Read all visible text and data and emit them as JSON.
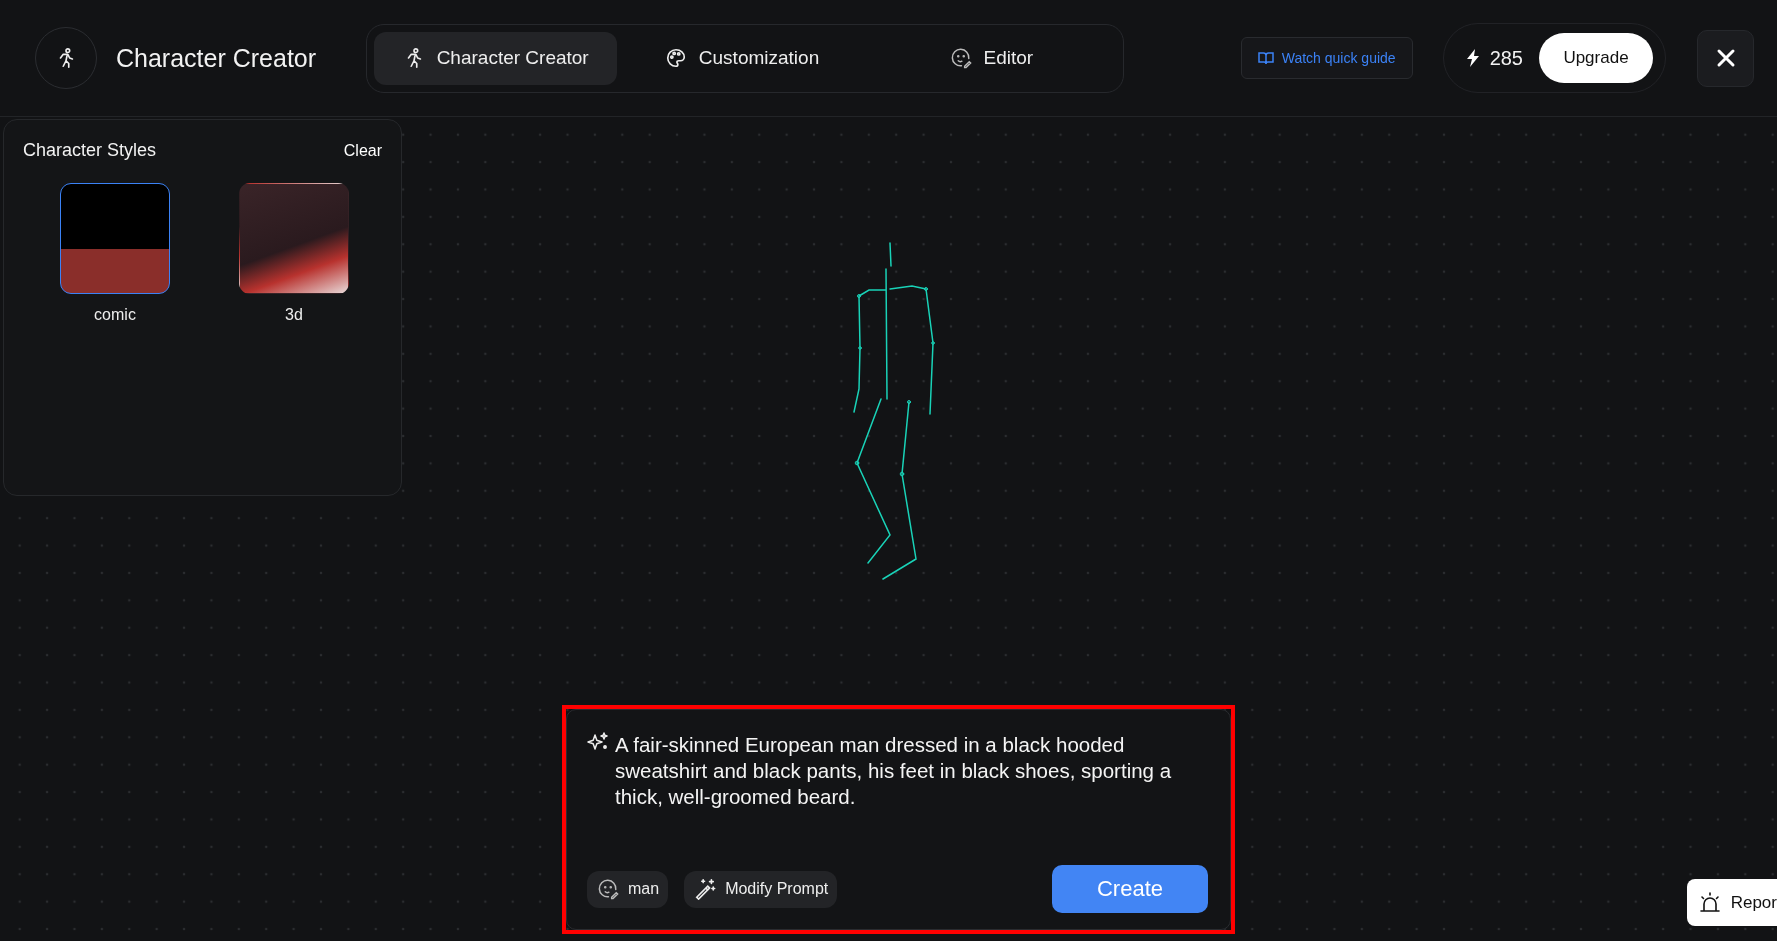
{
  "header": {
    "title": "Character Creator"
  },
  "tabs": [
    {
      "label": "Character Creator",
      "selected": true
    },
    {
      "label": "Customization",
      "selected": false
    },
    {
      "label": "Editor",
      "selected": false
    }
  ],
  "guide_link": "Watch quick guide",
  "credits": "285",
  "upgrade_button": "Upgrade",
  "styles_panel": {
    "title": "Character Styles",
    "clear": "Clear",
    "styles": [
      {
        "label": "comic",
        "selected": true
      },
      {
        "label": "3d",
        "selected": false
      }
    ]
  },
  "prompt": {
    "text": "A fair-skinned European man dressed in a black hooded sweatshirt and black pants, his feet in black shoes, sporting a thick, well-groomed beard.",
    "chips": [
      "man",
      "Modify Prompt"
    ],
    "create_button": "Create"
  },
  "report_button": "Repor"
}
